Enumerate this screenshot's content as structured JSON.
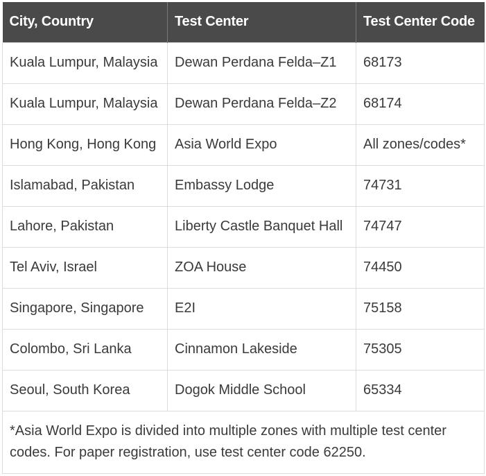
{
  "table": {
    "headers": [
      "City, Country",
      "Test Center",
      "Test Center Code"
    ],
    "rows": [
      [
        "Kuala Lumpur, Malaysia",
        "Dewan Perdana Felda–Z1",
        "68173"
      ],
      [
        "Kuala Lumpur, Malaysia",
        "Dewan Perdana Felda–Z2",
        "68174"
      ],
      [
        "Hong Kong, Hong Kong",
        "Asia World Expo",
        "All zones/codes*"
      ],
      [
        "Islamabad, Pakistan",
        "Embassy Lodge",
        "74731"
      ],
      [
        "Lahore, Pakistan",
        "Liberty Castle Banquet Hall",
        "74747"
      ],
      [
        "Tel Aviv, Israel",
        "ZOA House",
        "74450"
      ],
      [
        "Singapore, Singapore",
        "E2I",
        "75158"
      ],
      [
        "Colombo, Sri Lanka",
        "Cinnamon Lakeside",
        "75305"
      ],
      [
        "Seoul, South Korea",
        "Dogok Middle School",
        "65334"
      ]
    ],
    "footnote": "*Asia World Expo is divided into multiple zones with multiple test center codes. For paper registration, use test center code 62250."
  },
  "colors": {
    "header_bg": "#4a4a4a",
    "header_text": "#ffffff",
    "body_text": "#3a3a3a",
    "border": "#dcdcdc"
  }
}
